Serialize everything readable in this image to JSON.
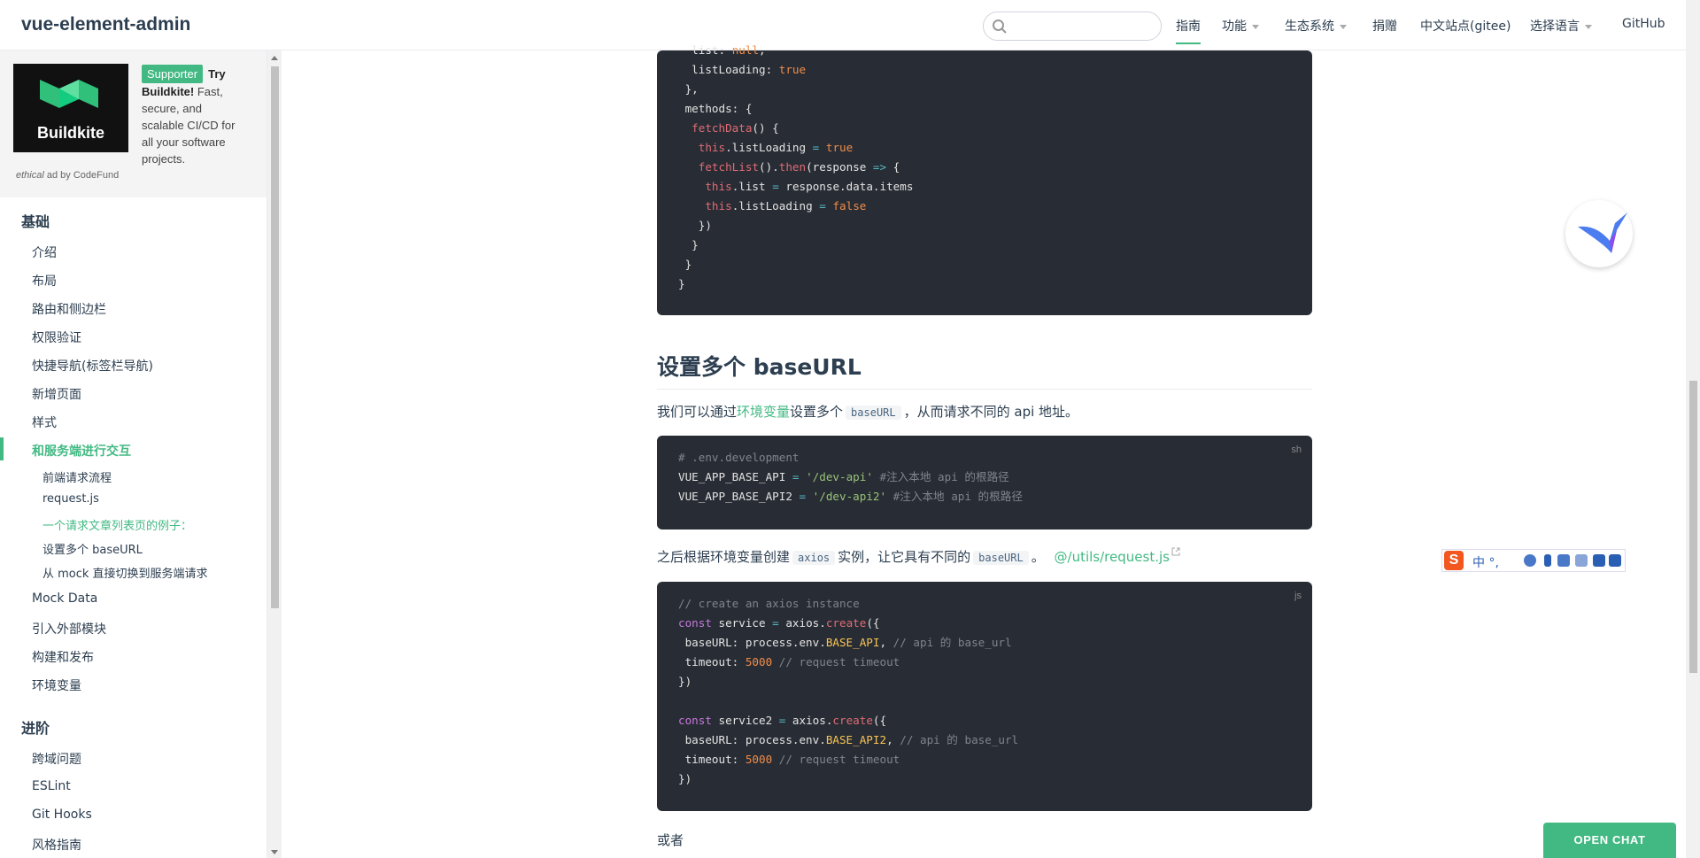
{
  "navbar": {
    "site_name": "vue-element-admin",
    "search_placeholder": "",
    "items": [
      {
        "label": "指南",
        "active": true,
        "dropdown": false
      },
      {
        "label": "功能",
        "active": false,
        "dropdown": true
      },
      {
        "label": "生态系统",
        "active": false,
        "dropdown": true
      },
      {
        "label": "捐赠",
        "active": false,
        "dropdown": false
      },
      {
        "label": "中文站点(gitee)",
        "active": false,
        "dropdown": false
      },
      {
        "label": "选择语言",
        "active": false,
        "dropdown": true
      },
      {
        "label": "GitHub",
        "active": false,
        "dropdown": false
      }
    ]
  },
  "ad": {
    "logo_text": "Buildkite",
    "badge": "Supporter",
    "headline": "Try Buildkite!",
    "body": "Fast, secure, and scalable CI/CD for all your software projects.",
    "credit_em": "ethical",
    "credit_rest": " ad by CodeFund"
  },
  "sidebar": {
    "group1_title": "基础",
    "group1_items": [
      "介绍",
      "布局",
      "路由和侧边栏",
      "权限验证",
      "快捷导航(标签栏导航)",
      "新增页面",
      "样式",
      "和服务端进行交互"
    ],
    "group1_sub": [
      "前端请求流程",
      "request.js",
      "一个请求文章列表页的例子：",
      "设置多个 baseURL",
      "从 mock 直接切换到服务端请求"
    ],
    "group1_more": [
      "Mock Data",
      "引入外部模块",
      "构建和发布",
      "环境变量"
    ],
    "group2_title": "进阶",
    "group2_items": [
      "跨域问题",
      "ESLint",
      "Git Hooks",
      "风格指南"
    ]
  },
  "content": {
    "heading": "设置多个 baseURL",
    "p1_before": "我们可以通过",
    "p1_link": "环境变量",
    "p1_middle": "设置多个",
    "p1_code": "baseURL",
    "p1_after": "，从而请求不同的 api 地址。",
    "p2_before": "之后根据环境变量创建",
    "p2_code1": "axios",
    "p2_middle": "实例，让它具有不同的",
    "p2_code2": "baseURL",
    "p2_after": "。",
    "p2_link": "@/utils/request.js",
    "p3": "或者",
    "code2_lang": "sh",
    "code3_lang": "js"
  },
  "ime": {
    "logo": "S",
    "text": "中 °,"
  },
  "chat": {
    "label": "OPEN CHAT"
  }
}
